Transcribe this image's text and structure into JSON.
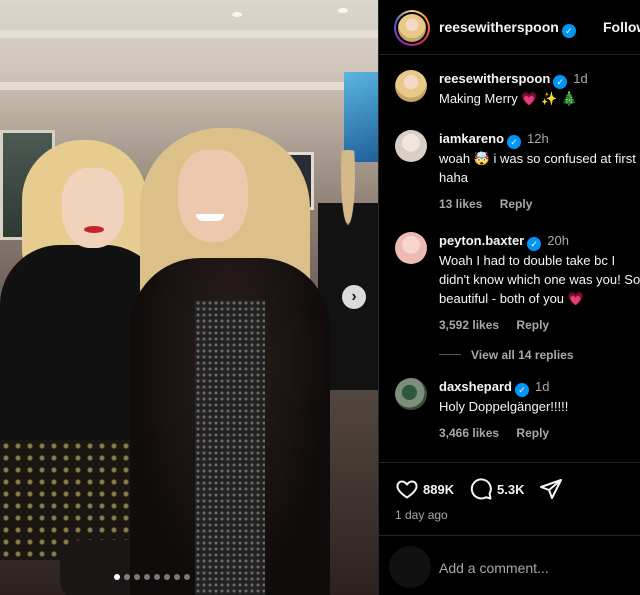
{
  "post": {
    "carousel": {
      "slide_count": 8,
      "active_index": 0,
      "next_symbol": "›"
    }
  },
  "header": {
    "username": "reesewitherspoon",
    "follow_label": "Follow"
  },
  "caption": {
    "username": "reesewitherspoon",
    "time": "1d",
    "text": "Making Merry 💗 ✨ 🎄"
  },
  "comments": [
    {
      "username": "iamkareno",
      "verified": true,
      "time": "12h",
      "text": "woah 🤯 i was so confused at first\nhaha",
      "likes": "13 likes",
      "reply": "Reply"
    },
    {
      "username": "peyton.baxter",
      "verified": true,
      "time": "20h",
      "text": "Woah I had to double take bc I\ndidn't know which one was you! So\nbeautiful - both of you 💗",
      "likes": "3,592 likes",
      "reply": "Reply"
    },
    {
      "username": "daxshepard",
      "verified": true,
      "time": "1d",
      "text": "Holy Doppelgänger!!!!!",
      "likes": "3,466 likes",
      "reply": "Reply"
    }
  ],
  "view_replies": "View all 14 replies",
  "actions": {
    "likes": "889K",
    "comments": "5.3K"
  },
  "posted_ago": "1 day ago",
  "add_comment": {
    "placeholder": "Add a comment..."
  },
  "icons": [
    "chevron-right-icon",
    "verified-icon",
    "heart-icon",
    "comment-icon",
    "share-icon"
  ],
  "colors": {
    "verified": "#0095f6",
    "muted": "#a8a8a8",
    "background": "#000000"
  }
}
